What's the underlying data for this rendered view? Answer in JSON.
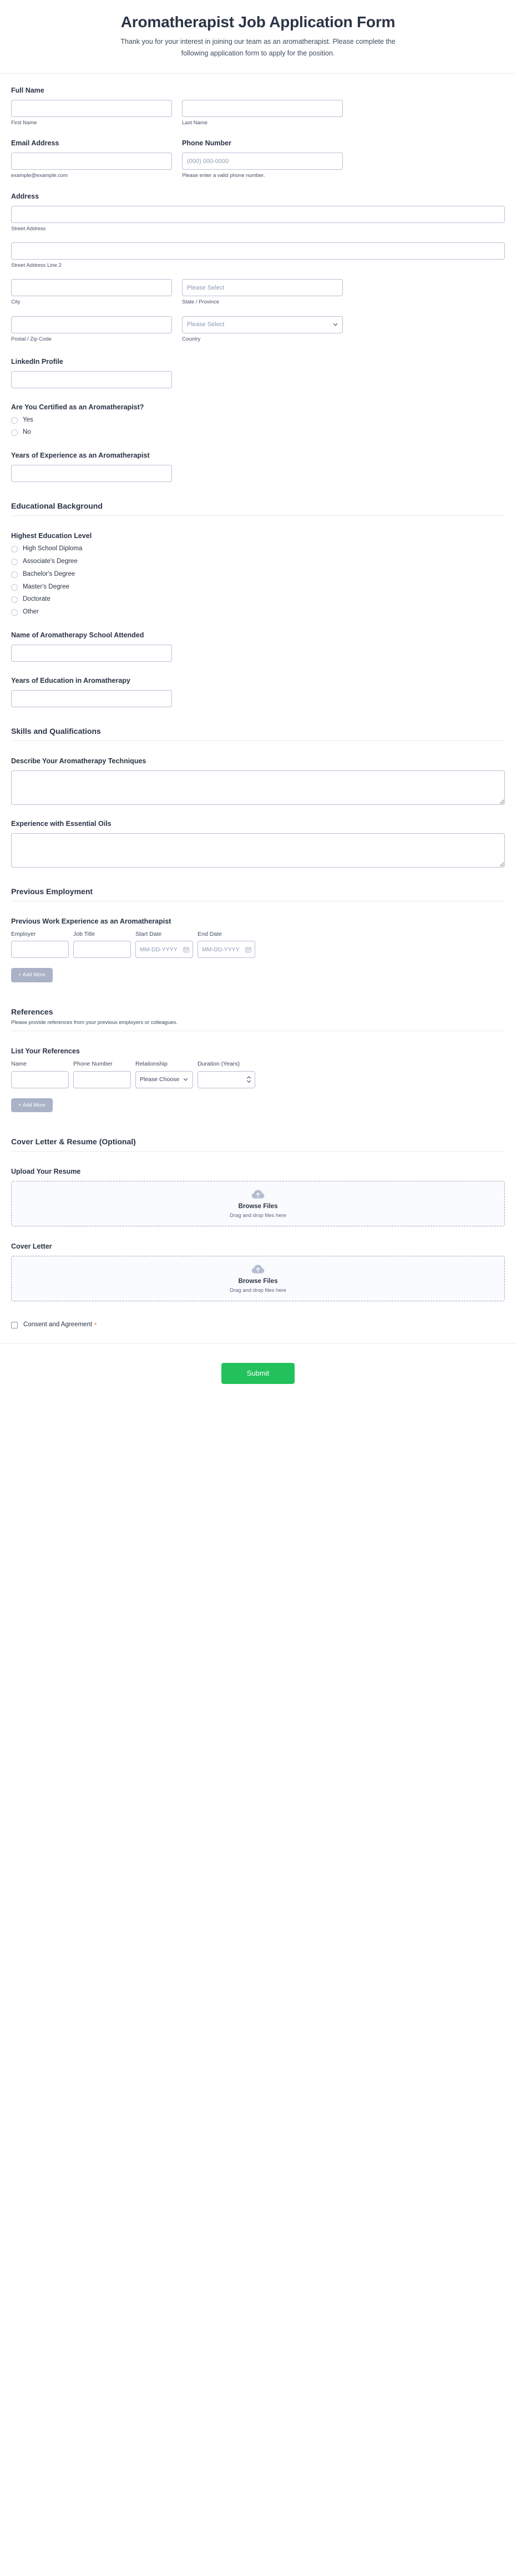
{
  "header": {
    "title": "Aromatherapist Job Application Form",
    "subtitle": "Thank you for your interest in joining our team as an aromatherapist. Please complete the following application form to apply for the position."
  },
  "personal": {
    "full_name": {
      "label": "Full Name",
      "first_sub": "First Name",
      "last_sub": "Last Name",
      "first_value": "",
      "last_value": ""
    },
    "email": {
      "label": "Email Address",
      "sub": "example@example.com",
      "value": "",
      "placeholder": ""
    },
    "phone": {
      "label": "Phone Number",
      "sub": "Please enter a valid phone number.",
      "value": "",
      "placeholder": "(000) 000-0000"
    },
    "address": {
      "label": "Address",
      "street_sub": "Street Address",
      "street2_sub": "Street Address Line 2",
      "city_sub": "City",
      "state_sub": "State / Province",
      "postal_sub": "Postal / Zip Code",
      "country_sub": "Country",
      "state_placeholder": "Please Select",
      "country_placeholder": "Please Select",
      "street_value": "",
      "street2_value": "",
      "city_value": "",
      "postal_value": ""
    },
    "linkedin": {
      "label": "LinkedIn Profile",
      "value": ""
    },
    "certified": {
      "label": "Are You Certified as an Aromatherapist?",
      "options": [
        "Yes",
        "No"
      ],
      "selected": ""
    },
    "years_experience": {
      "label": "Years of Experience as an Aromatherapist",
      "value": ""
    }
  },
  "education": {
    "section_title": "Educational Background",
    "highest_level": {
      "label": "Highest Education Level",
      "options": [
        "High School Diploma",
        "Associate's Degree",
        "Bachelor's Degree",
        "Master's Degree",
        "Doctorate",
        "Other"
      ],
      "selected": ""
    },
    "school_name": {
      "label": "Name of Aromatherapy School Attended",
      "value": ""
    },
    "years_education": {
      "label": "Years of Education in Aromatherapy",
      "value": ""
    }
  },
  "skills": {
    "section_title": "Skills and Qualifications",
    "techniques": {
      "label": "Describe Your Aromatherapy Techniques",
      "value": ""
    },
    "essential_oils": {
      "label": "Experience with Essential Oils",
      "value": ""
    }
  },
  "employment": {
    "section_title": "Previous Employment",
    "table_label": "Previous Work Experience as an Aromatherapist",
    "columns": [
      "Employer",
      "Job Title",
      "Start Date",
      "End Date"
    ],
    "row_values": [
      "",
      "",
      "",
      ""
    ],
    "date_placeholder": "MM-DD-YYYY",
    "add_more_label": "+ Add More"
  },
  "references": {
    "section_title": "References",
    "section_desc": "Please provide references from your previous employers or colleagues.",
    "table_label": "List Your References",
    "columns": [
      "Name",
      "Phone Number",
      "Relationship",
      "Duration (Years)"
    ],
    "row_values": [
      "",
      "",
      "",
      ""
    ],
    "relationship_placeholder": "Please Choose",
    "add_more_label": "+ Add More"
  },
  "attachments": {
    "section_title": "Cover Letter & Resume (Optional)",
    "resume": {
      "label": "Upload Your Resume",
      "browse_label": "Browse Files",
      "drop_label": "Drag and drop files here"
    },
    "cover_letter": {
      "label": "Cover Letter",
      "browse_label": "Browse Files",
      "drop_label": "Drag and drop files here"
    }
  },
  "consent": {
    "label": "Consent and Agreement",
    "required_marker": "*",
    "checked": false
  },
  "submit": {
    "label": "Submit"
  },
  "colors": {
    "submit_green": "#22c15c",
    "add_more_gray": "#aab2c8",
    "required_orange": "#d9663d",
    "text_dark": "#2b3346",
    "border_gray": "#b8bfd3"
  }
}
